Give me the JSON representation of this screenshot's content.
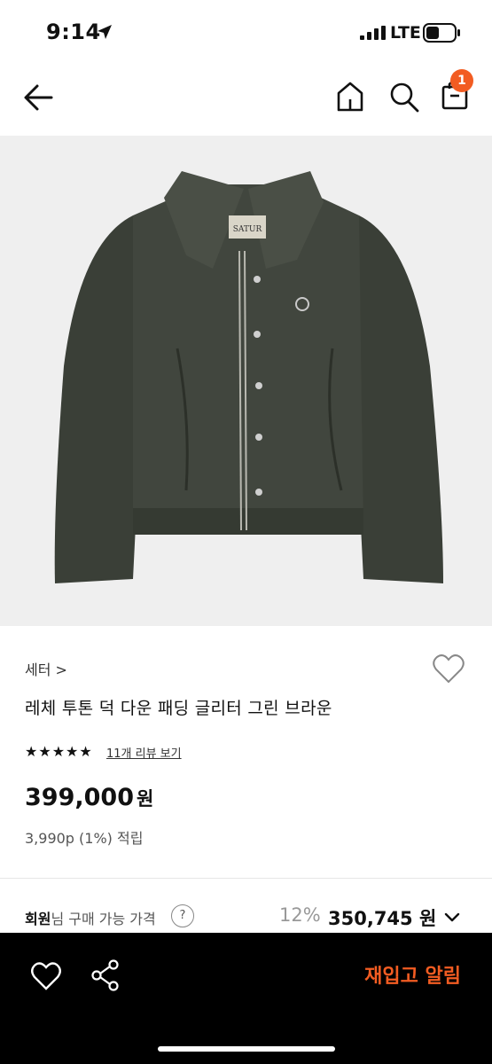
{
  "status_bar": {
    "time": "9:14",
    "network": "LTE"
  },
  "nav": {
    "cart_count": "1"
  },
  "product": {
    "brand_logo_text": "SATUR",
    "category": "세터 >",
    "name": "레체 투톤 덕 다운 패딩 글리터 그린 브라운",
    "rating_stars": 5,
    "review_link": "11개 리뷰 보기",
    "price": "399,000",
    "price_unit": "원",
    "points": "3,990p (1%) 적립"
  },
  "member_price": {
    "label_bold": "회원",
    "label_rest": "님 구매 가능 가격",
    "help": "?",
    "discount": "12%",
    "price": "350,745 원"
  },
  "bottom_bar": {
    "restock_label": "재입고 알림"
  },
  "colors": {
    "accent": "#f25c22",
    "jacket": "#3d423a"
  },
  "icons": [
    "back-arrow-icon",
    "home-icon",
    "search-icon",
    "shopping-bag-icon",
    "heart-outline-icon",
    "share-icon",
    "chevron-down-icon",
    "star-icon",
    "location-arrow-icon",
    "signal-icon",
    "battery-icon"
  ]
}
